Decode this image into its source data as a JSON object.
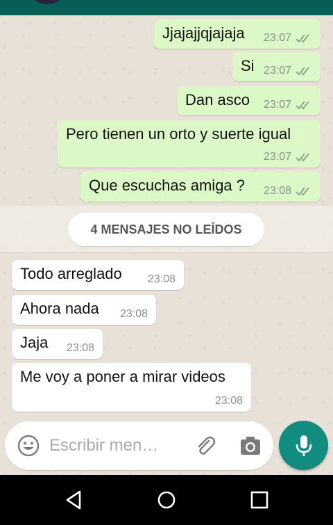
{
  "colors": {
    "header": "#075e54",
    "outgoing_bubble": "#dcf8c6",
    "incoming_bubble": "#ffffff",
    "accent": "#128c7e",
    "tick": "#8a9a8a"
  },
  "messages": [
    {
      "direction": "out",
      "text": "Jjajajjqjajaja",
      "time": "23:07",
      "status_icon": "double-check-icon"
    },
    {
      "direction": "out",
      "text": "Si",
      "time": "23:07",
      "status_icon": "double-check-icon"
    },
    {
      "direction": "out",
      "text": "Dan asco",
      "time": "23:07",
      "status_icon": "double-check-icon"
    },
    {
      "direction": "out",
      "text": "Pero tienen un orto y suerte igual",
      "time": "23:07",
      "status_icon": "double-check-icon"
    },
    {
      "direction": "out",
      "text": "Que escuchas amiga ?",
      "time": "23:08",
      "status_icon": "double-check-icon"
    },
    {
      "direction": "in",
      "text": "Todo arreglado",
      "time": "23:08"
    },
    {
      "direction": "in",
      "text": "Ahora nada",
      "time": "23:08"
    },
    {
      "direction": "in",
      "text": "Jaja",
      "time": "23:08"
    },
    {
      "direction": "in",
      "text": "Me voy a poner a mirar videos",
      "time": "23:08"
    }
  ],
  "unread_banner": "4 MENSAJES NO LEÍDOS",
  "composer": {
    "placeholder": "Escribir men…",
    "emoji_icon": "emoji-icon",
    "attach_icon": "paperclip-icon",
    "camera_icon": "camera-icon",
    "send_icon": "microphone-icon"
  },
  "navbar": {
    "back_icon": "back-triangle-icon",
    "home_icon": "home-circle-icon",
    "recents_icon": "recents-square-icon"
  }
}
